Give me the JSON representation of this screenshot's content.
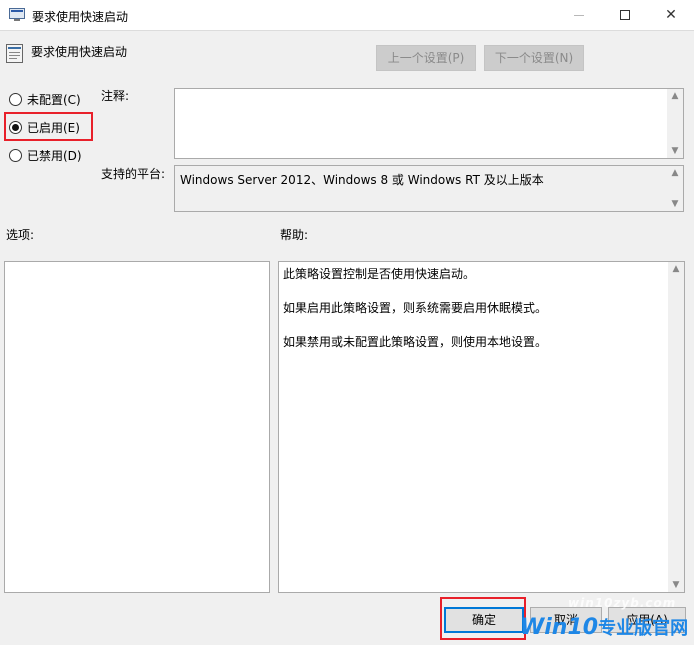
{
  "window": {
    "title": "要求使用快速启动",
    "minimize_glyph": "—",
    "maximize_glyph": "☐",
    "close_glyph": "✕"
  },
  "header": {
    "policy_name": "要求使用快速启动",
    "prev_setting": "上一个设置(P)",
    "next_setting": "下一个设置(N)"
  },
  "radios": {
    "not_configured": "未配置(C)",
    "enabled": "已启用(E)",
    "disabled": "已禁用(D)",
    "selected": "enabled"
  },
  "comment": {
    "label": "注释:",
    "value": ""
  },
  "platform": {
    "label": "支持的平台:",
    "value": "Windows Server 2012、Windows 8 或 Windows RT 及以上版本"
  },
  "options": {
    "label": "选项:"
  },
  "help": {
    "label": "帮助:",
    "lines": [
      "此策略设置控制是否使用快速启动。",
      "如果启用此策略设置，则系统需要启用休眠模式。",
      "如果禁用或未配置此策略设置，则使用本地设置。"
    ]
  },
  "buttons": {
    "ok": "确定",
    "cancel": "取消",
    "apply": "应用(A)"
  },
  "watermark": {
    "url": "win10zyb.com",
    "brand": "Win10",
    "brand_cn": "专业版官网"
  },
  "colors": {
    "highlight_red": "#e8202a",
    "watermark_blue": "#1e87e6"
  }
}
